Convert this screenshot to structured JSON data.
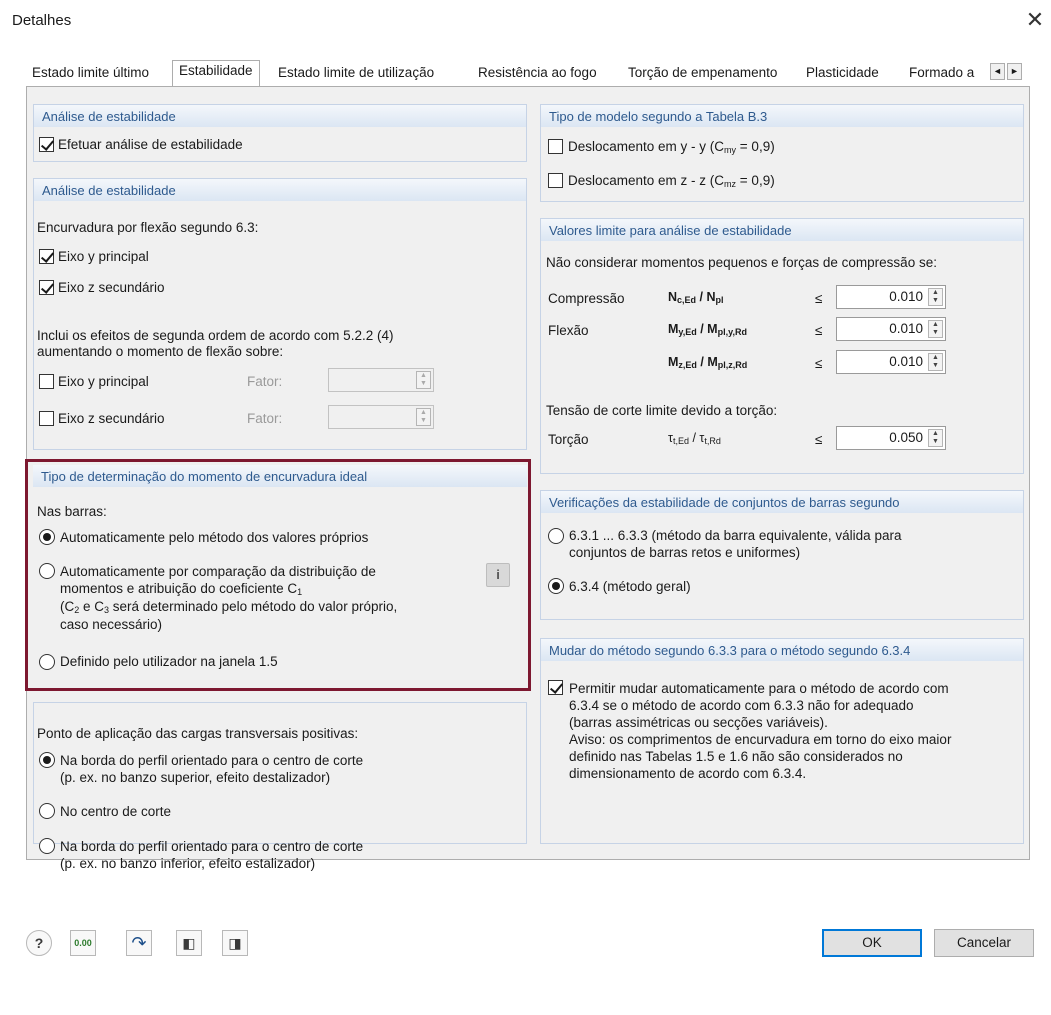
{
  "window": {
    "title": "Detalhes",
    "close_glyph": "✕"
  },
  "tabs": [
    {
      "label": "Estado limite último",
      "active": false
    },
    {
      "label": "Estabilidade",
      "active": true
    },
    {
      "label": "Estado limite de utilização",
      "active": false
    },
    {
      "label": "Resistência ao fogo",
      "active": false
    },
    {
      "label": "Torção de empenamento",
      "active": false
    },
    {
      "label": "Plasticidade",
      "active": false
    },
    {
      "label": "Formado a",
      "active": false
    }
  ],
  "tab_scroll": {
    "left": "◄",
    "right": "►"
  },
  "left": {
    "stability_analysis": {
      "header": "Análise de estabilidade",
      "perform_label": "Efetuar análise de estabilidade",
      "perform_checked": true
    },
    "stability_analysis2": {
      "header": "Análise de estabilidade",
      "flexural_label": "Encurvadura por flexão segundo 6.3:",
      "axis_y_label": "Eixo y principal",
      "axis_y_checked": true,
      "axis_z_label": "Eixo z secundário",
      "axis_z_checked": true,
      "second_order_line1": "Inclui os efeitos de segunda ordem de acordo com 5.2.2 (4)",
      "second_order_line2": "aumentando o momento de flexão sobre:",
      "so_axis_y_label": "Eixo y principal",
      "so_axis_y_checked": false,
      "so_axis_z_label": "Eixo z secundário",
      "so_axis_z_checked": false,
      "factor_label": "Fator:"
    },
    "ideal_moment": {
      "header": "Tipo de determinação do momento de encurvadura ideal",
      "members_label": "Nas barras:",
      "opt1": "Automaticamente pelo método dos valores próprios",
      "opt2_line1": "Automaticamente por comparação da distribuição de",
      "opt2_line2": "momentos e atribuição do coeficiente C",
      "opt2_sub": "1",
      "opt2_line3_a": "(C",
      "opt2_line3_sub2": "2",
      "opt2_line3_b": " e C",
      "opt2_line3_sub3": "3",
      "opt2_line3_c": " será determinado pelo método do valor próprio,",
      "opt2_line4": "caso necessário)",
      "opt3": "Definido pelo utilizador na janela 1.5",
      "selected": 1,
      "info_glyph": "i"
    },
    "load_application": {
      "header": "Ponto de aplicação das cargas transversais positivas:",
      "opt1_line1": "Na borda do perfil orientado para o centro de corte",
      "opt1_line2": "(p. ex. no banzo superior, efeito destalizador)",
      "opt2": "No centro de corte",
      "opt3_line1": "Na borda do perfil orientado para o centro de corte",
      "opt3_line2": "(p. ex. no banzo inferior, efeito estalizador)",
      "selected": 1
    }
  },
  "right": {
    "model_type": {
      "header": "Tipo de modelo segundo a Tabela B.3",
      "opt1": "Deslocamento em y - y (C",
      "opt1_sub": "my",
      "opt1_end": " = 0,9)",
      "opt1_checked": false,
      "opt2": "Deslocamento em z - z (C",
      "opt2_sub": "mz",
      "opt2_end": " = 0,9)",
      "opt2_checked": false
    },
    "limits": {
      "header": "Valores limite para análise de estabilidade",
      "intro": "Não considerar momentos pequenos e forças de compressão se:",
      "compression_label": "Compressão",
      "compression_formula_a": "N",
      "compression_formula_sub": "c,Ed",
      "compression_formula_b": " / N",
      "compression_formula_sub2": "pl",
      "le": "≤",
      "compression_value": "0.010",
      "bending_label": "Flexão",
      "my_formula_a": "M",
      "my_formula_sub": "y,Ed",
      "my_formula_b": " / M",
      "my_formula_sub2": "pl,y,Rd",
      "my_value": "0.010",
      "mz_formula_a": "M",
      "mz_formula_sub": "z,Ed",
      "mz_formula_b": " / M",
      "mz_formula_sub2": "pl,z,Rd",
      "mz_value": "0.010",
      "shear_intro": "Tensão de corte limite devido a torção:",
      "torsion_label": "Torção",
      "torsion_formula_a": "τ",
      "torsion_formula_sub": "t,Ed",
      "torsion_formula_b": " / τ",
      "torsion_formula_sub2": "t,Rd",
      "torsion_value": "0.050"
    },
    "verification": {
      "header": "Verificações da estabilidade de conjuntos de barras segundo",
      "opt1_line1": "6.3.1 ... 6.3.3 (método da barra equivalente, válida para",
      "opt1_line2": "conjuntos de barras retos e uniformes)",
      "opt2": "6.3.4  (método geral)",
      "selected": 2
    },
    "method_switch": {
      "header": "Mudar do método segundo 6.3.3 para o método segundo 6.3.4",
      "checked": true,
      "line1": "Permitir mudar automaticamente para o método de acordo com",
      "line2": "6.3.4 se o método de acordo com 6.3.3 não for adequado",
      "line3": "(barras assimétricas ou secções variáveis).",
      "line4": "Aviso: os comprimentos de encurvadura em torno do eixo maior",
      "line5": "definido nas Tabelas 1.5 e 1.6 não são considerados no",
      "line6": "dimensionamento de acordo com 6.3.4."
    }
  },
  "toolbar": {
    "help_glyph": "?",
    "units_glyph": "0.00",
    "arrow_glyph": "↷",
    "import_glyph": "◧",
    "export_glyph": "◨"
  },
  "buttons": {
    "ok": "OK",
    "cancel": "Cancelar"
  },
  "colors": {
    "group_header_text": "#2e5a8e",
    "highlight_border": "#7d1830",
    "panel_bg": "#f0f0f0"
  }
}
